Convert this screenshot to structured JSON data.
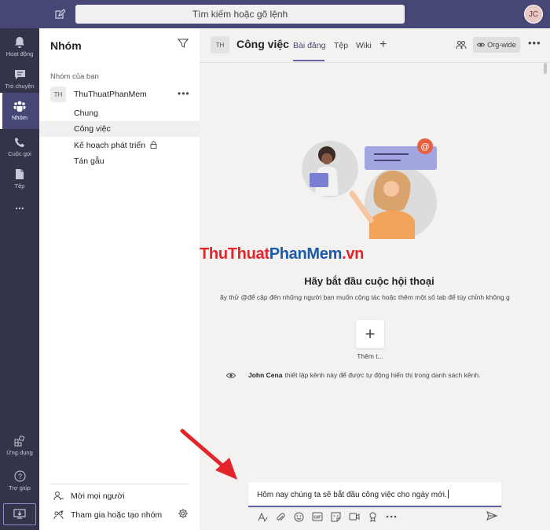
{
  "topbar": {
    "search_placeholder": "Tìm kiếm hoặc gõ lệnh",
    "avatar_initials": "JC"
  },
  "rail": {
    "items": [
      {
        "label": "Hoạt động",
        "icon": "bell-icon"
      },
      {
        "label": "Trò chuyện",
        "icon": "chat-icon"
      },
      {
        "label": "Nhóm",
        "icon": "teams-icon",
        "active": true
      },
      {
        "label": "Cuộc gọi",
        "icon": "phone-icon"
      },
      {
        "label": "Tệp",
        "icon": "file-icon"
      },
      {
        "label": "...",
        "icon": "more-icon"
      }
    ],
    "bottom": [
      {
        "label": "Ứng dụng",
        "icon": "apps-icon"
      },
      {
        "label": "Trợ giúp",
        "icon": "help-icon"
      }
    ]
  },
  "panel": {
    "title": "Nhóm",
    "section_label": "Nhóm của bạn",
    "team": {
      "initials": "TH",
      "name": "ThuThuatPhanMem",
      "more": "•••"
    },
    "channels": [
      {
        "name": "Chung"
      },
      {
        "name": "Công việc",
        "selected": true
      },
      {
        "name": "Kế hoạch phát triển",
        "locked": true
      },
      {
        "name": "Tán gẫu"
      }
    ],
    "footer": {
      "invite_label": "Mời mọi người",
      "join_label": "Tham gia hoặc tạo nhóm"
    }
  },
  "channel_header": {
    "initials": "TH",
    "name": "Công việc",
    "tabs": [
      "Bài đăng",
      "Tệp",
      "Wiki"
    ],
    "active_tab": "Bài đăng",
    "orgwide_label": "Org-wide",
    "more": "•••"
  },
  "main": {
    "watermark_part1": "ThuThuat",
    "watermark_part2": "PhanMem",
    "watermark_part3": ".vn",
    "start_title": "Hãy bắt đầu cuộc hội thoại",
    "start_description": "ãy thử @để cập đến những người bạn muốn cộng tác hoặc thêm một số tab để tùy chỉnh không g",
    "add_tile_symbol": "+",
    "add_tile_label": "Thêm t...",
    "system_message": {
      "author": "John Cena",
      "text": "thiết lập kênh này để được tự động hiển thị trong danh sách kênh."
    }
  },
  "compose": {
    "text": "Hôm nay chúng ta sẽ bắt đầu công việc cho ngày mới.",
    "tools": [
      "format-icon",
      "attach-icon",
      "emoji-icon",
      "gif-icon",
      "sticker-icon",
      "meet-icon",
      "praise-icon",
      "more-icon"
    ]
  },
  "colors": {
    "accent": "#6264a7",
    "rail_bg": "#33344a",
    "topbar_bg": "#464775",
    "annotation_arrow": "#e3242b"
  }
}
